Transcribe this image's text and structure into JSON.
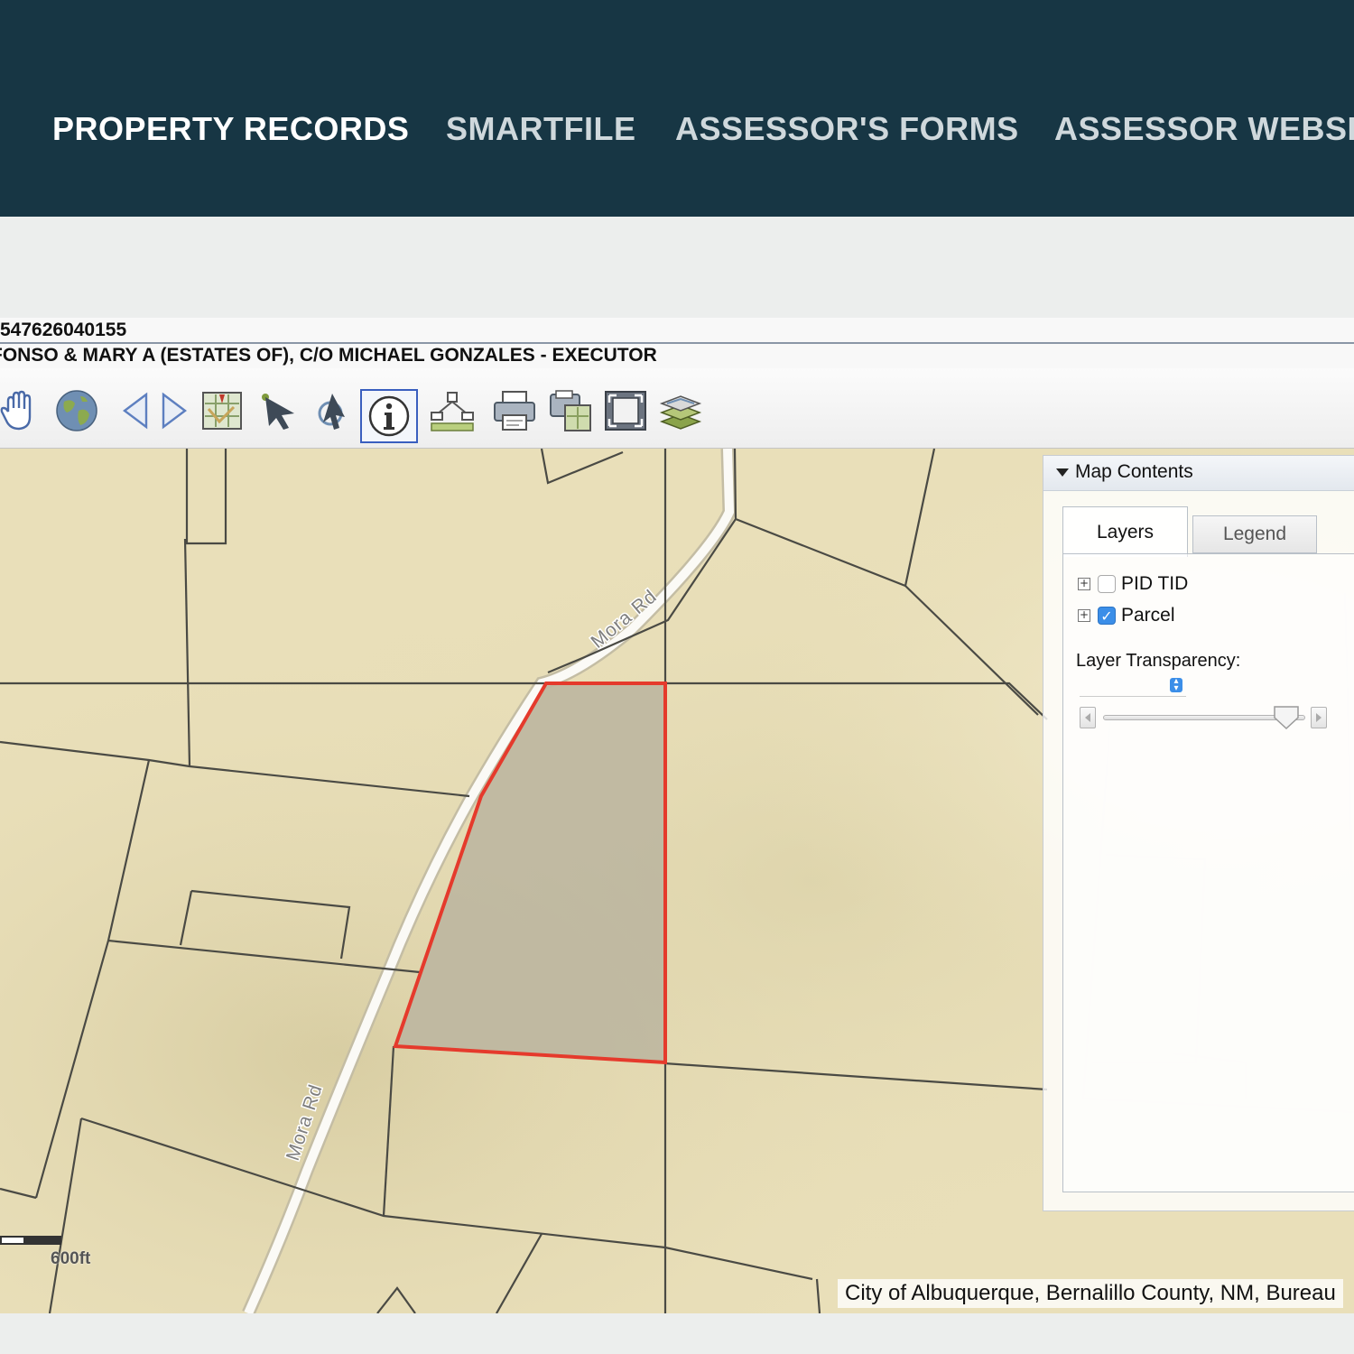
{
  "nav": {
    "items": [
      {
        "label": "PROPERTY RECORDS"
      },
      {
        "label": "SMARTFILE"
      },
      {
        "label": "ASSESSOR'S FORMS"
      },
      {
        "label": "ASSESSOR WEBSI"
      }
    ]
  },
  "record": {
    "pid": "547626040155",
    "owner": "FONSO & MARY A (ESTATES OF), C/O MICHAEL GONZALES - EXECUTOR"
  },
  "toolbar": {
    "tools": [
      {
        "icon": "pan-hand-icon"
      },
      {
        "icon": "globe-full-extent-icon"
      },
      {
        "icon": "previous-extent-icon"
      },
      {
        "icon": "next-extent-icon"
      },
      {
        "icon": "map-bookmark-icon"
      },
      {
        "icon": "select-arrow-icon"
      },
      {
        "icon": "select-identify-arrow-icon"
      },
      {
        "icon": "info-identify-icon",
        "active": true
      },
      {
        "icon": "measure-icon"
      },
      {
        "icon": "print-icon"
      },
      {
        "icon": "export-map-icon"
      },
      {
        "icon": "fullscreen-icon"
      },
      {
        "icon": "layers-icon"
      }
    ]
  },
  "map": {
    "roads": [
      {
        "label": "Mora Rd"
      },
      {
        "label": "Mora Rd"
      }
    ],
    "scale_label": "600ft",
    "attribution": "City of Albuquerque, Bernalillo County, NM, Bureau",
    "colors": {
      "highlight": "#e53a2c",
      "basemap": "#e9dfb9",
      "parcel_fill": "#bdb6a0"
    }
  },
  "panel": {
    "title": "Map Contents",
    "tabs": [
      {
        "label": "Layers",
        "selected": true
      },
      {
        "label": "Legend",
        "selected": false
      }
    ],
    "layers": [
      {
        "label": "PID TID",
        "checked": false
      },
      {
        "label": "Parcel",
        "checked": true
      }
    ],
    "transparency_label": "Layer Transparency:",
    "transparency_value": 0.9
  }
}
